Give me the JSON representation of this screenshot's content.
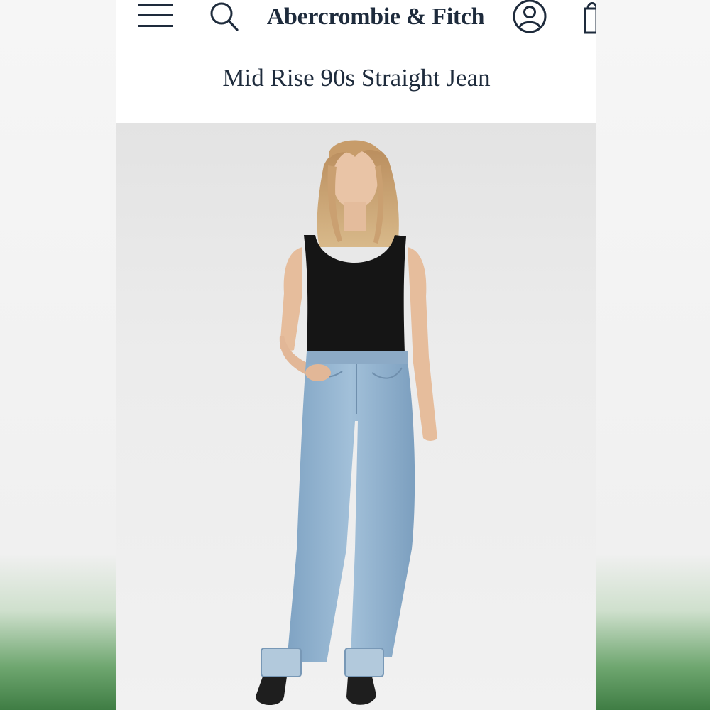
{
  "header": {
    "brand": "Abercrombie & Fitch",
    "icons": [
      "menu-icon",
      "search-icon",
      "account-icon",
      "bag-icon"
    ]
  },
  "product": {
    "title": "Mid Rise 90s Straight Jean"
  },
  "colors": {
    "brand_navy": "#1e2b3c",
    "denim": "#8fb2cf",
    "tank": "#141414"
  }
}
